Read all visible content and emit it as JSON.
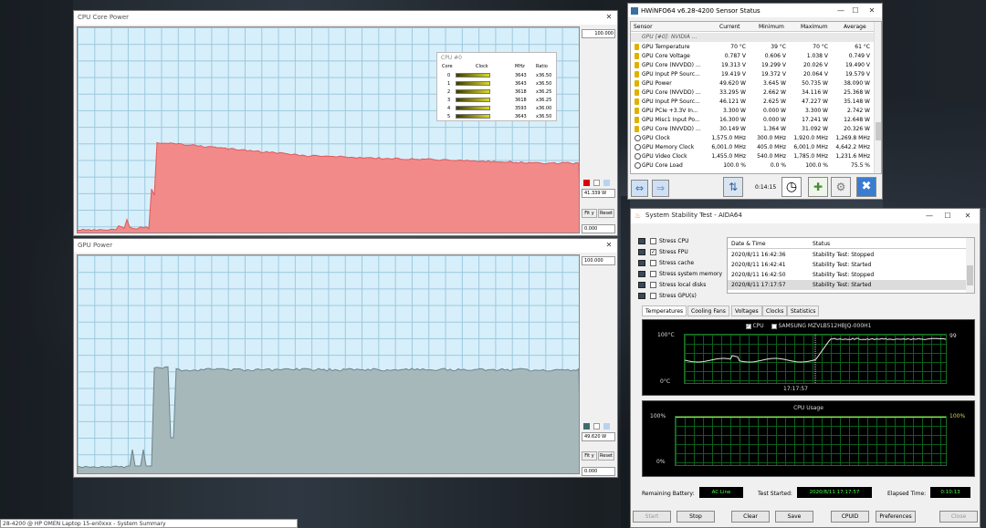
{
  "cpu_power_window": {
    "title": "CPU Core Power",
    "max_value": "100.000",
    "current_value": "41.339 W",
    "min_value": "0.000",
    "fit_y_label": "Fit y",
    "reset_label": "Reset",
    "color": "#f28a8a",
    "overlay": {
      "title": "CPU #0",
      "headers": [
        "Core",
        "Clock",
        "MHz",
        "Ratio"
      ],
      "rows": [
        {
          "core": "0",
          "mhz": "3643",
          "ratio": "x36.50"
        },
        {
          "core": "1",
          "mhz": "3643",
          "ratio": "x36.50"
        },
        {
          "core": "2",
          "mhz": "3618",
          "ratio": "x36.25"
        },
        {
          "core": "3",
          "mhz": "3618",
          "ratio": "x36.25"
        },
        {
          "core": "4",
          "mhz": "3593",
          "ratio": "x36.00"
        },
        {
          "core": "5",
          "mhz": "3643",
          "ratio": "x36.50"
        }
      ]
    }
  },
  "gpu_power_window": {
    "title": "GPU Power",
    "max_value": "100.000",
    "current_value": "49.620 W",
    "min_value": "0.000",
    "fit_y_label": "Fit y",
    "reset_label": "Reset",
    "color": "#a7b8bb"
  },
  "hwinfo": {
    "title": "HWiNFO64 v6.28-4200 Sensor Status",
    "headers": [
      "Sensor",
      "Current",
      "Minimum",
      "Maximum",
      "Average"
    ],
    "group": "GPU [#0]: NVIDIA ...",
    "rows": [
      {
        "icon": "bolt",
        "name": "GPU Temperature",
        "cur": "70 °C",
        "min": "39 °C",
        "max": "70 °C",
        "avg": "61 °C"
      },
      {
        "icon": "bolt",
        "name": "GPU Core Voltage",
        "cur": "0.787 V",
        "min": "0.606 V",
        "max": "1.038 V",
        "avg": "0.749 V"
      },
      {
        "icon": "bolt",
        "name": "GPU Core (NVVDD) ...",
        "cur": "19.313 V",
        "min": "19.299 V",
        "max": "20.026 V",
        "avg": "19.490 V"
      },
      {
        "icon": "bolt",
        "name": "GPU Input PP Sourc...",
        "cur": "19.419 V",
        "min": "19.372 V",
        "max": "20.064 V",
        "avg": "19.579 V"
      },
      {
        "icon": "bolt",
        "name": "GPU Power",
        "cur": "49.620 W",
        "min": "3.645 W",
        "max": "50.735 W",
        "avg": "38.090 W"
      },
      {
        "icon": "bolt",
        "name": "GPU Core (NVVDD) ...",
        "cur": "33.295 W",
        "min": "2.662 W",
        "max": "34.116 W",
        "avg": "25.368 W"
      },
      {
        "icon": "bolt",
        "name": "GPU Input PP Sourc...",
        "cur": "46.121 W",
        "min": "2.625 W",
        "max": "47.227 W",
        "avg": "35.148 W"
      },
      {
        "icon": "bolt",
        "name": "GPU PCIe +3.3V In...",
        "cur": "3.300 W",
        "min": "0.000 W",
        "max": "3.300 W",
        "avg": "2.742 W"
      },
      {
        "icon": "bolt",
        "name": "GPU Misc1 Input Po...",
        "cur": "16.300 W",
        "min": "0.000 W",
        "max": "17.241 W",
        "avg": "12.648 W"
      },
      {
        "icon": "bolt",
        "name": "GPU Core (NVVDD) ...",
        "cur": "30.149 W",
        "min": "1.364 W",
        "max": "31.092 W",
        "avg": "20.326 W"
      },
      {
        "icon": "clock",
        "name": "GPU Clock",
        "cur": "1,575.0 MHz",
        "min": "300.0 MHz",
        "max": "1,920.0 MHz",
        "avg": "1,269.8 MHz"
      },
      {
        "icon": "clock",
        "name": "GPU Memory Clock",
        "cur": "6,001.0 MHz",
        "min": "405.0 MHz",
        "max": "6,001.0 MHz",
        "avg": "4,642.2 MHz"
      },
      {
        "icon": "clock",
        "name": "GPU Video Clock",
        "cur": "1,455.0 MHz",
        "min": "540.0 MHz",
        "max": "1,785.0 MHz",
        "avg": "1,231.6 MHz"
      },
      {
        "icon": "clock",
        "name": "GPU Core Load",
        "cur": "100.0 %",
        "min": "0.0 %",
        "max": "100.0 %",
        "avg": "75.5 %"
      }
    ],
    "elapsed": "0:14:15"
  },
  "aida": {
    "title": "System Stability Test - AIDA64",
    "stress_items": [
      {
        "label": "Stress CPU",
        "checked": false
      },
      {
        "label": "Stress FPU",
        "checked": true
      },
      {
        "label": "Stress cache",
        "checked": false
      },
      {
        "label": "Stress system memory",
        "checked": false
      },
      {
        "label": "Stress local disks",
        "checked": false
      },
      {
        "label": "Stress GPU(s)",
        "checked": false
      }
    ],
    "log_headers": [
      "Date & Time",
      "Status"
    ],
    "log": [
      {
        "time": "2020/8/11 16:42:36",
        "status": "Stability Test: Stopped"
      },
      {
        "time": "2020/8/11 16:42:41",
        "status": "Stability Test: Started"
      },
      {
        "time": "2020/8/11 16:42:50",
        "status": "Stability Test: Stopped"
      },
      {
        "time": "2020/8/11 17:17:57",
        "status": "Stability Test: Started"
      }
    ],
    "tabs": [
      "Temperatures",
      "Cooling Fans",
      "Voltages",
      "Clocks",
      "Statistics"
    ],
    "temp_legend_cpu": "CPU",
    "temp_legend_disk": "SAMSUNG MZVLB512HBJQ-000H1",
    "temp_top": "100°C",
    "temp_bottom": "0°C",
    "temp_marker": "17:17:57",
    "temp_value": "99",
    "usage_title": "CPU Usage",
    "usage_top_left": "100%",
    "usage_top_right": "100%",
    "usage_bottom": "0%",
    "remaining_battery_label": "Remaining Battery:",
    "remaining_battery_value": "AC Line",
    "test_started_label": "Test Started:",
    "test_started_value": "2020/8/11 17:17:57",
    "elapsed_label": "Elapsed Time:",
    "elapsed_value": "0:10:13",
    "buttons": {
      "start": "Start",
      "stop": "Stop",
      "clear": "Clear",
      "save": "Save",
      "cpuid": "CPUID",
      "preferences": "Preferences",
      "close": "Close"
    }
  },
  "bottom_window": {
    "title": "28-4200 @ HP OMEN Laptop 15-en0xxx - System Summary"
  }
}
